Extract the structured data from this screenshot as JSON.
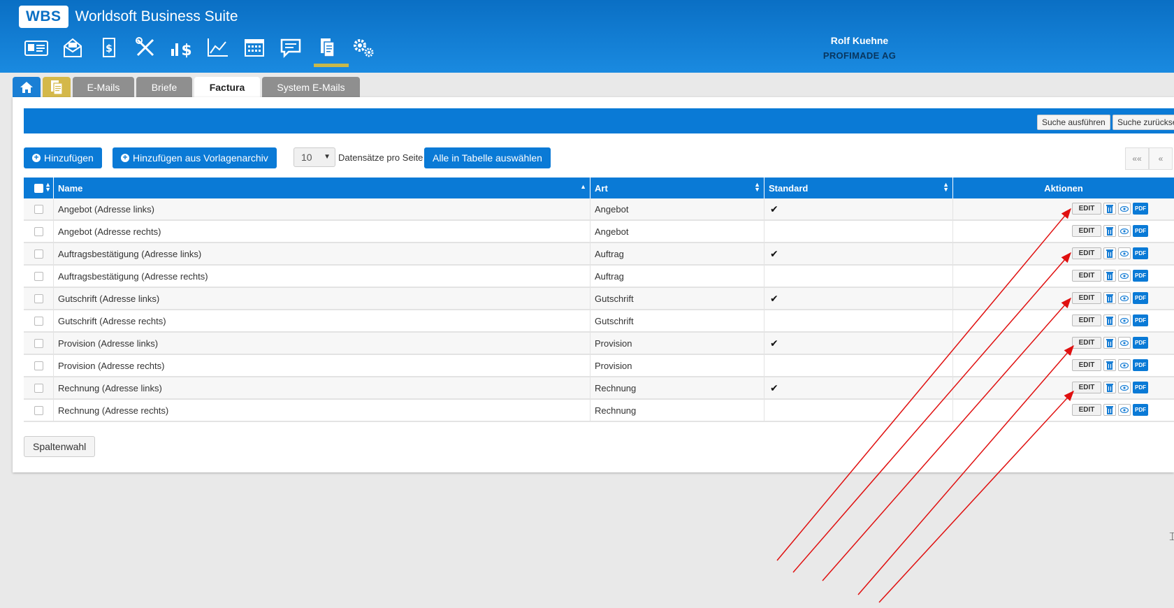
{
  "app": {
    "logo_badge": "WBS",
    "title": "Worldsoft Business Suite"
  },
  "user": {
    "name": "Rolf Kuehne",
    "company": "PROFIMADE AG"
  },
  "nav_icons": [
    "contacts-icon",
    "mail-icon",
    "invoice-icon",
    "tools-icon",
    "finance-icon",
    "chart-icon",
    "calendar-icon",
    "chat-icon",
    "documents-icon",
    "settings-icon"
  ],
  "tabs": [
    "E-Mails",
    "Briefe",
    "Factura",
    "System E-Mails"
  ],
  "active_tab": "Factura",
  "search": {
    "execute_label": "Suche ausführen",
    "reset_label": "Suche zurücksetze"
  },
  "toolbar": {
    "add_label": "Hinzufügen",
    "add_from_archive_label": "Hinzufügen aus Vorlagenarchiv",
    "page_size": "10",
    "per_page_label": "Datensätze pro Seite",
    "select_all_label": "Alle in Tabelle auswählen",
    "pager_first": "««",
    "pager_prev": "«"
  },
  "table": {
    "headers": [
      "Name",
      "Art",
      "Standard",
      "Aktionen"
    ],
    "rows": [
      {
        "name": "Angebot (Adresse links)",
        "art": "Angebot",
        "standard": "✔"
      },
      {
        "name": "Angebot (Adresse rechts)",
        "art": "Angebot",
        "standard": ""
      },
      {
        "name": "Auftragsbestätigung (Adresse links)",
        "art": "Auftrag",
        "standard": "✔"
      },
      {
        "name": "Auftragsbestätigung (Adresse rechts)",
        "art": "Auftrag",
        "standard": ""
      },
      {
        "name": "Gutschrift (Adresse links)",
        "art": "Gutschrift",
        "standard": "✔"
      },
      {
        "name": "Gutschrift (Adresse rechts)",
        "art": "Gutschrift",
        "standard": ""
      },
      {
        "name": "Provision (Adresse links)",
        "art": "Provision",
        "standard": "✔"
      },
      {
        "name": "Provision (Adresse rechts)",
        "art": "Provision",
        "standard": ""
      },
      {
        "name": "Rechnung (Adresse links)",
        "art": "Rechnung",
        "standard": "✔"
      },
      {
        "name": "Rechnung (Adresse rechts)",
        "art": "Rechnung",
        "standard": ""
      }
    ],
    "action_labels": {
      "edit": "EDIT",
      "pdf": "PDF"
    }
  },
  "column_select_label": "Spaltenwahl",
  "colors": {
    "primary": "#0a7ad6",
    "header_gradient_top": "#0a6fc4",
    "tab_inactive": "#8f8f8f",
    "annotation_arrow": "#e01010"
  }
}
